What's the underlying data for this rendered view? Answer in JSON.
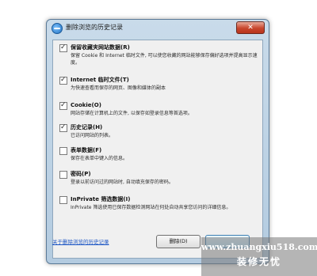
{
  "window": {
    "title": "删除浏览的历史记录",
    "close_glyph": "✕"
  },
  "options": [
    {
      "checked": true,
      "title": "保留收藏夹网站数据(R)",
      "description": "保留 Cookie 和 Internet 临时文件, 可以使您收藏的网站能够保存偏好选项并提高显示速度。"
    },
    {
      "checked": true,
      "title": "Internet 临时文件(T)",
      "description": "为快速查看而保存的网页、图像和媒体的副本"
    },
    {
      "checked": true,
      "title": "Cookie(O)",
      "description": "网站存储在计算机上的文件, 以保存如登录信息等首选项。"
    },
    {
      "checked": true,
      "title": "历史记录(H)",
      "description": "已访问网站的列表。"
    },
    {
      "checked": false,
      "title": "表单数据(F)",
      "description": "保存在表单中键入的信息。"
    },
    {
      "checked": false,
      "title": "密码(P)",
      "description": "登录以前访问过的网站时, 自动填充保存的密码。"
    },
    {
      "checked": false,
      "title": "InPrivate 筛选数据(I)",
      "description": "InPrivate 筛选使用已保存数据检测网站在何处自动共享您访问的详细信息。"
    }
  ],
  "footer": {
    "link_label": "关于删除浏览的历史记录",
    "delete_label": "删除(D)"
  },
  "watermark": {
    "url": "www.zhuangxiu518.com",
    "name": "装修无忧"
  }
}
